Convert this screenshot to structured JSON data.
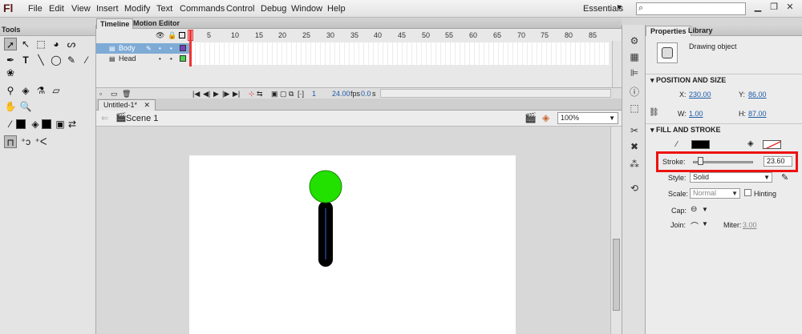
{
  "app": {
    "logo": "Fl",
    "menus": [
      "File",
      "Edit",
      "View",
      "Insert",
      "Modify",
      "Text",
      "Commands",
      "Control",
      "Debug",
      "Window",
      "Help"
    ],
    "workspace": "Essentials",
    "search_placeholder": ""
  },
  "tools_panel": {
    "title": "Tools"
  },
  "timeline": {
    "tabs": [
      "Timeline",
      "Motion Editor"
    ],
    "frame_numbers": [
      "5",
      "10",
      "15",
      "20",
      "25",
      "30",
      "35",
      "40",
      "45",
      "50",
      "55",
      "60",
      "65",
      "70",
      "75",
      "80",
      "85"
    ],
    "layers": [
      {
        "name": "Body",
        "selected": true,
        "color": "#7a3fc0"
      },
      {
        "name": "Head",
        "selected": false,
        "color": "#4cd04c"
      }
    ],
    "current_frame": "1",
    "fps": "24.00",
    "fps_unit": "fps",
    "elapsed": "0.0",
    "elapsed_unit": "s"
  },
  "document": {
    "tab_title": "Untitled-1*",
    "scene": "Scene 1",
    "zoom": "100%"
  },
  "stage": {
    "head_color": "#22e000",
    "body_color": "#000000"
  },
  "properties": {
    "tabs": [
      "Properties",
      "Library"
    ],
    "object_type": "Drawing object",
    "position_size": {
      "title": "POSITION AND SIZE",
      "x_label": "X:",
      "x": "230.00",
      "y_label": "Y:",
      "y": "86.00",
      "w_label": "W:",
      "w": "1.00",
      "h_label": "H:",
      "h": "87.00"
    },
    "fill_stroke": {
      "title": "FILL AND STROKE",
      "stroke_label": "Stroke:",
      "stroke_value": "23.60",
      "stroke_slider_fraction": 0.12,
      "style_label": "Style:",
      "style_value": "Solid",
      "scale_label": "Scale:",
      "scale_value": "Normal",
      "hinting_label": "Hinting",
      "cap_label": "Cap:",
      "join_label": "Join:",
      "miter_label": "Miter:",
      "miter_value": "3.00"
    }
  }
}
